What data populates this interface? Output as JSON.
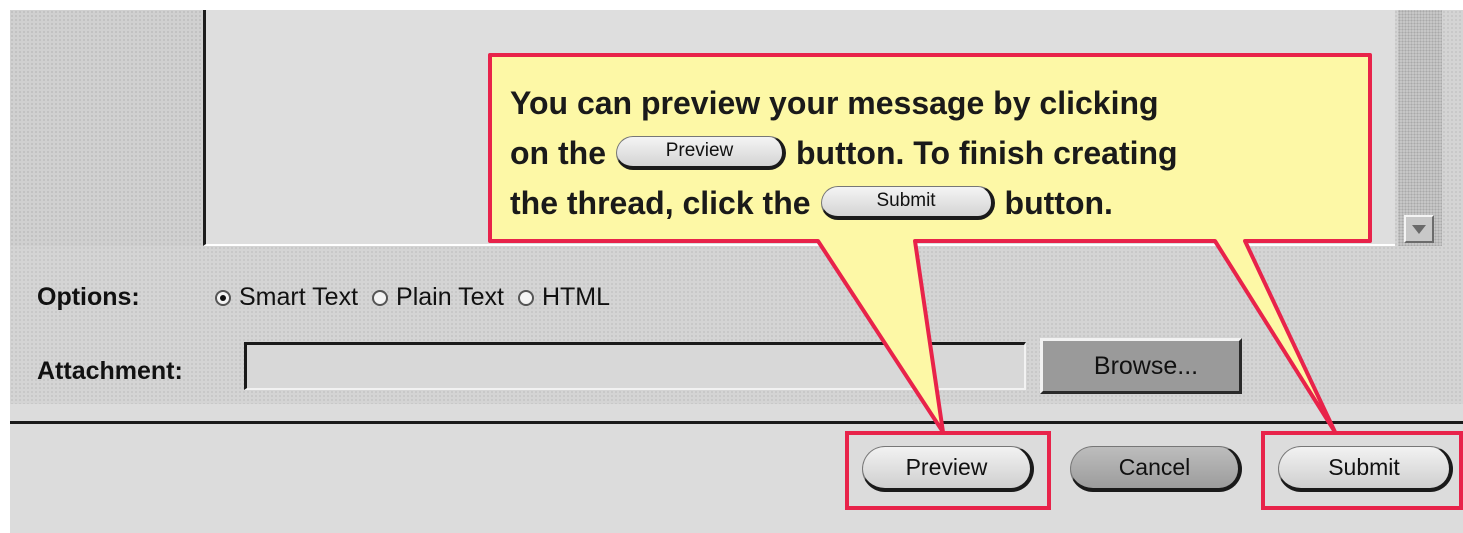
{
  "form": {
    "options_label": "Options:",
    "radio_options": [
      {
        "label": "Smart Text",
        "checked": true
      },
      {
        "label": "Plain Text",
        "checked": false
      },
      {
        "label": "HTML",
        "checked": false
      }
    ],
    "attachment_label": "Attachment:",
    "attachment_value": "",
    "browse_label": "Browse..."
  },
  "buttons": {
    "preview": "Preview",
    "cancel": "Cancel",
    "submit": "Submit"
  },
  "callout": {
    "line1": "You can preview your message by clicking",
    "line2_a": "on the",
    "line2_button": "Preview",
    "line2_b": "button.  To finish creating",
    "line3_a": "the thread, click the",
    "line3_button": "Submit",
    "line3_b": "button."
  },
  "colors": {
    "callout_fill": "#fdf8a6",
    "highlight": "#e8234a"
  }
}
